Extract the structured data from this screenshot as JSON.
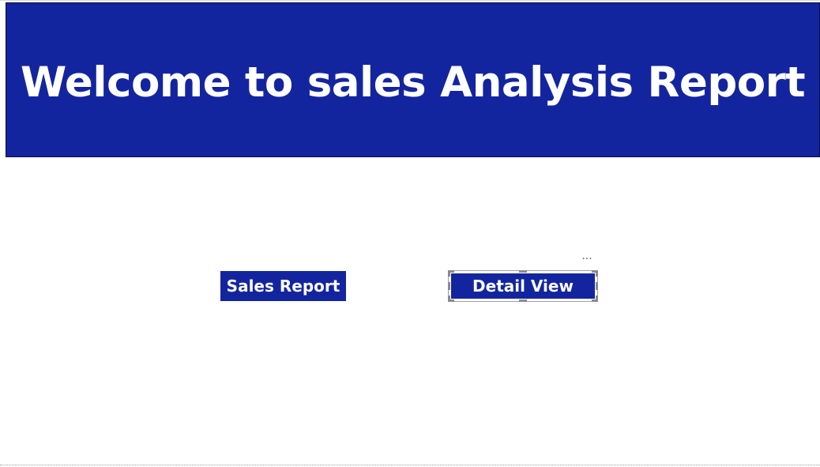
{
  "header": {
    "title": "Welcome to sales Analysis Report"
  },
  "buttons": {
    "sales_report": "Sales Report",
    "detail_view": "Detail View"
  },
  "visual_header": {
    "more_options_glyph": "···",
    "more_options_icon": "more-options-icon"
  },
  "colors": {
    "primary": "#13259E",
    "text_on_primary": "#FFFFFF",
    "background": "#FFFFFF",
    "selection": "#8A8A8A"
  }
}
